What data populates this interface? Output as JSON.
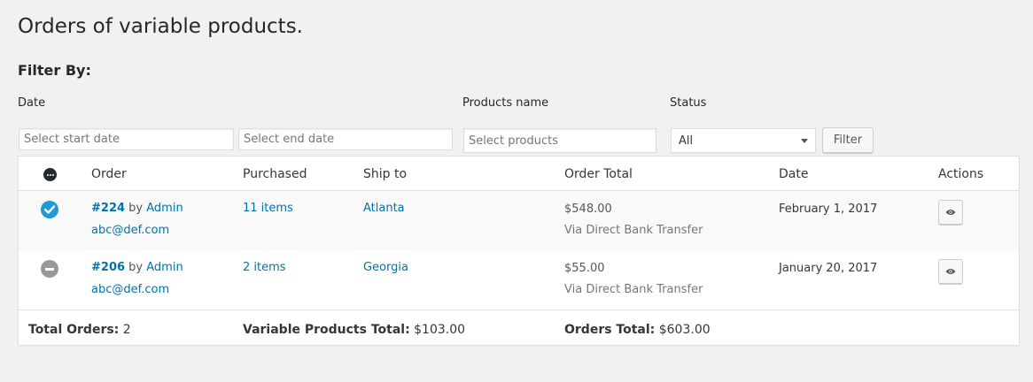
{
  "page": {
    "title": "Orders of variable products.",
    "filter_heading": "Filter By:"
  },
  "filters": {
    "date_label": "Date",
    "start_date_placeholder": "Select start date",
    "end_date_placeholder": "Select end date",
    "products_label": "Products name",
    "products_placeholder": "Select products",
    "status_label": "Status",
    "status_selected": "All",
    "filter_button": "Filter"
  },
  "table": {
    "columns": [
      "Order",
      "Purchased",
      "Ship to",
      "Order Total",
      "Date",
      "Actions"
    ],
    "rows": [
      {
        "status": "completed",
        "order_number": "#224",
        "by_text": "by",
        "customer": "Admin",
        "email": "abc@def.com",
        "purchased": "11 items",
        "ship_to": "Atlanta",
        "total": "$548.00",
        "payment_method": "Via Direct Bank Transfer",
        "date": "February 1, 2017"
      },
      {
        "status": "cancelled",
        "order_number": "#206",
        "by_text": "by",
        "customer": "Admin",
        "email": "abc@def.com",
        "purchased": "2 items",
        "ship_to": "Georgia",
        "total": "$55.00",
        "payment_method": "Via Direct Bank Transfer",
        "date": "January 20, 2017"
      }
    ],
    "footer": {
      "total_orders_label": "Total Orders:",
      "total_orders_value": "2",
      "variable_total_label": "Variable Products Total:",
      "variable_total_value": "$103.00",
      "orders_total_label": "Orders Total:",
      "orders_total_value": "$603.00"
    }
  },
  "colors": {
    "link": "#0073aa",
    "status_completed": "#1e9ad6",
    "status_cancelled": "#999999",
    "background": "#f1f1f1"
  },
  "icons": {
    "header_status": "status-ellipsis-icon",
    "completed": "check-circle-icon",
    "cancelled": "minus-circle-icon",
    "view": "eye-icon",
    "select_caret": "chevron-down-icon"
  }
}
